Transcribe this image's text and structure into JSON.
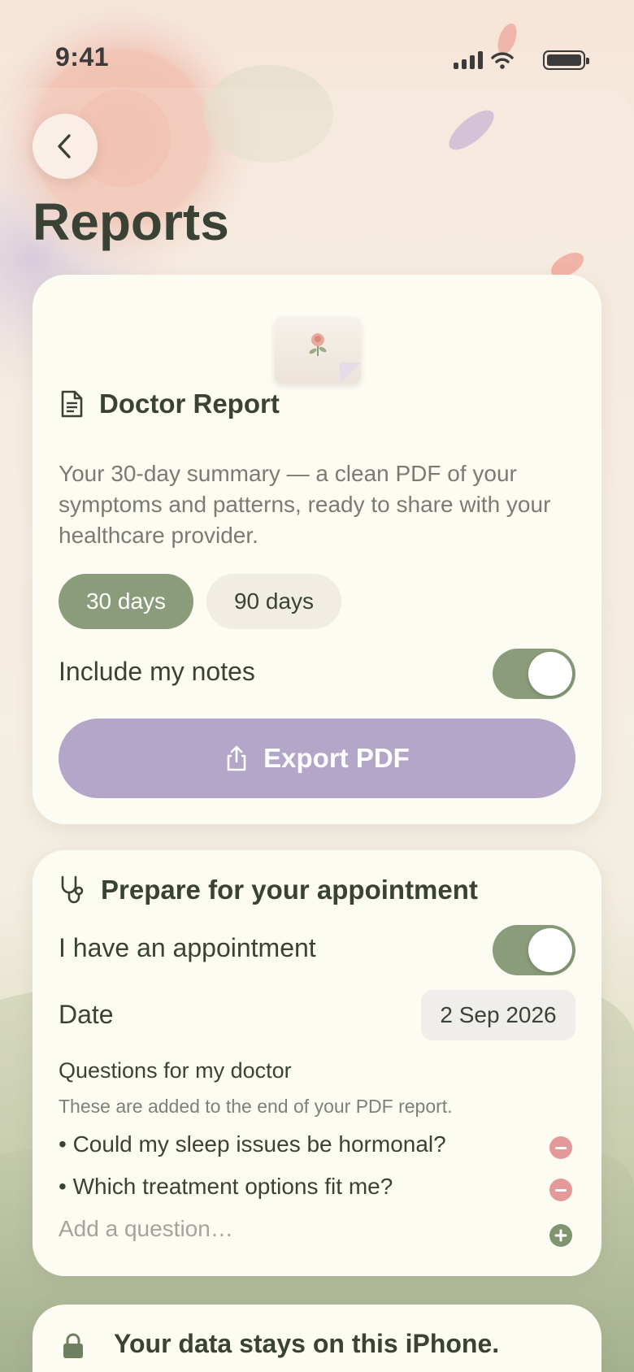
{
  "status_bar": {
    "time": "9:41"
  },
  "page": {
    "title": "Reports"
  },
  "colors": {
    "accent_green": "#8a9c7a",
    "accent_lavender": "#b3a6c9",
    "remove_red": "#e39a98"
  },
  "doctor_report": {
    "title": "Doctor Report",
    "description": "Your 30-day summary — a clean PDF of your symptoms and patterns, ready to share with your healthcare provider.",
    "range_options": [
      "30 days",
      "90 days"
    ],
    "selected_range": "30 days",
    "include_notes_label": "Include my notes",
    "include_notes": true,
    "export_label": "Export PDF"
  },
  "appointment": {
    "title": "Prepare for your appointment",
    "has_appointment_label": "I have an appointment",
    "has_appointment": true,
    "date_label": "Date",
    "date_value": "2 Sep 2026",
    "questions_title": "Questions for my doctor",
    "questions_subtitle": "These are added to the end of your PDF report.",
    "questions": [
      "• Could my sleep issues be hormonal?",
      "• Which treatment options fit me?"
    ],
    "add_placeholder": "Add a question…"
  },
  "privacy": {
    "text": "Your data stays on this iPhone."
  },
  "icons": [
    "back-chevron-icon",
    "document-icon",
    "share-icon",
    "stethoscope-icon",
    "remove-icon",
    "add-icon",
    "lock-icon",
    "signal-icon",
    "wifi-icon",
    "battery-icon"
  ]
}
